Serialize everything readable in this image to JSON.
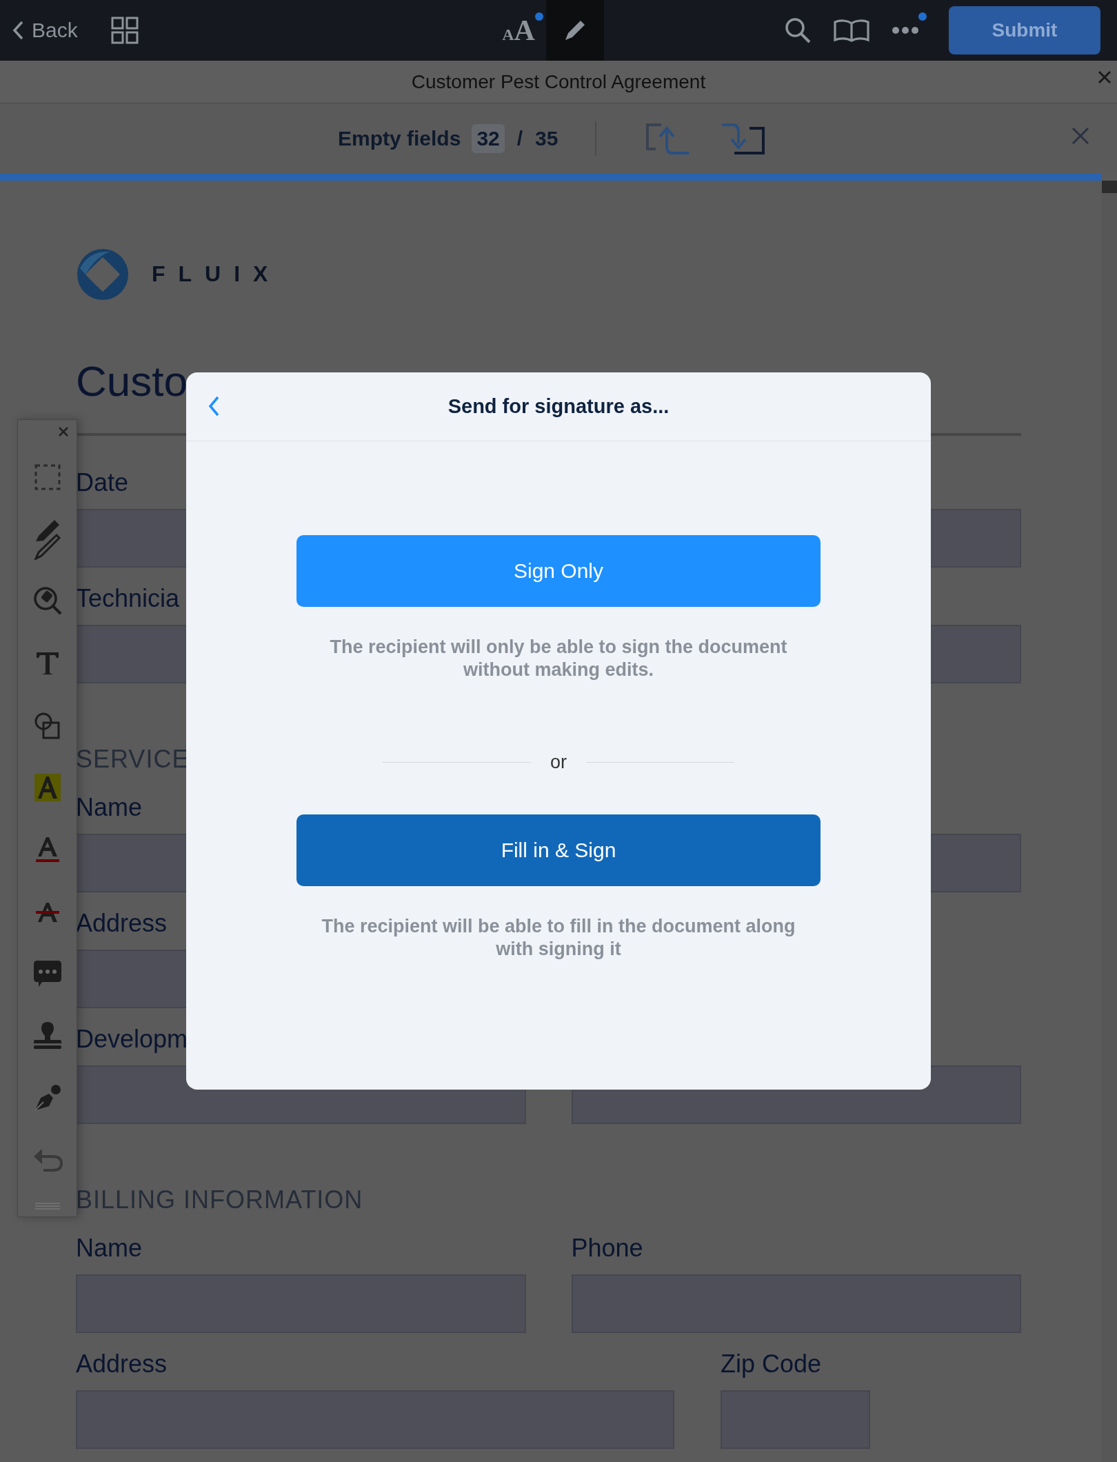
{
  "app_bar": {
    "back": "Back",
    "center_actions": [
      {
        "kind": "text-size",
        "glyphs": [
          "A",
          "A"
        ],
        "dot": true,
        "selected": false
      },
      {
        "kind": "markup",
        "dot": false,
        "selected": true
      }
    ],
    "right_actions": [
      {
        "kind": "search",
        "dot": false
      },
      {
        "kind": "bookmarks",
        "dot": false
      },
      {
        "kind": "more",
        "dot": true
      }
    ],
    "submit": "Submit"
  },
  "title_bar": {
    "title": "Customer Pest Control Agreement"
  },
  "fields_bar": {
    "label": "Empty fields",
    "empty": "32",
    "separator": "/",
    "total": "35"
  },
  "progress": {
    "level": 1
  },
  "document": {
    "logo": "FLUIX",
    "title": "Custo",
    "rows": [
      {
        "kind": "two",
        "fields": [
          {
            "kind": "labeled",
            "label": "Date"
          },
          {
            "kind": "bare"
          }
        ]
      },
      {
        "kind": "two",
        "fields": [
          {
            "kind": "labeled",
            "label": "Technicia"
          },
          {
            "kind": "bare"
          }
        ]
      },
      {
        "kind": "heading",
        "text": "SERVICE"
      },
      {
        "kind": "two",
        "fields": [
          {
            "kind": "labeled",
            "label": "Name"
          },
          {
            "kind": "bare"
          }
        ]
      },
      {
        "kind": "wide",
        "fields": [
          {
            "kind": "labeled",
            "label": "Address"
          }
        ]
      },
      {
        "kind": "two",
        "fields": [
          {
            "kind": "labeled",
            "label": "Developm"
          },
          {
            "kind": "bare"
          }
        ]
      },
      {
        "kind": "heading",
        "text": "BILLING INFORMATION"
      },
      {
        "kind": "two",
        "fields": [
          {
            "kind": "labeled",
            "label": "Name"
          },
          {
            "kind": "labeled",
            "label": "Phone"
          }
        ]
      },
      {
        "kind": "wide",
        "fields": [
          {
            "kind": "labeled",
            "label": "Address"
          },
          {
            "kind": "labeled",
            "label": "Zip Code"
          }
        ]
      }
    ]
  },
  "dialog": {
    "title": "Send for signature as...",
    "items": [
      {
        "kind": "primary",
        "label": "Sign Only",
        "description": "The recipient will only be able to sign the document without making edits."
      },
      {
        "kind": "divider",
        "text": "or"
      },
      {
        "kind": "secondary",
        "label": "Fill in & Sign",
        "description": "The recipient will be able to fill in the document along with signing it"
      }
    ]
  }
}
